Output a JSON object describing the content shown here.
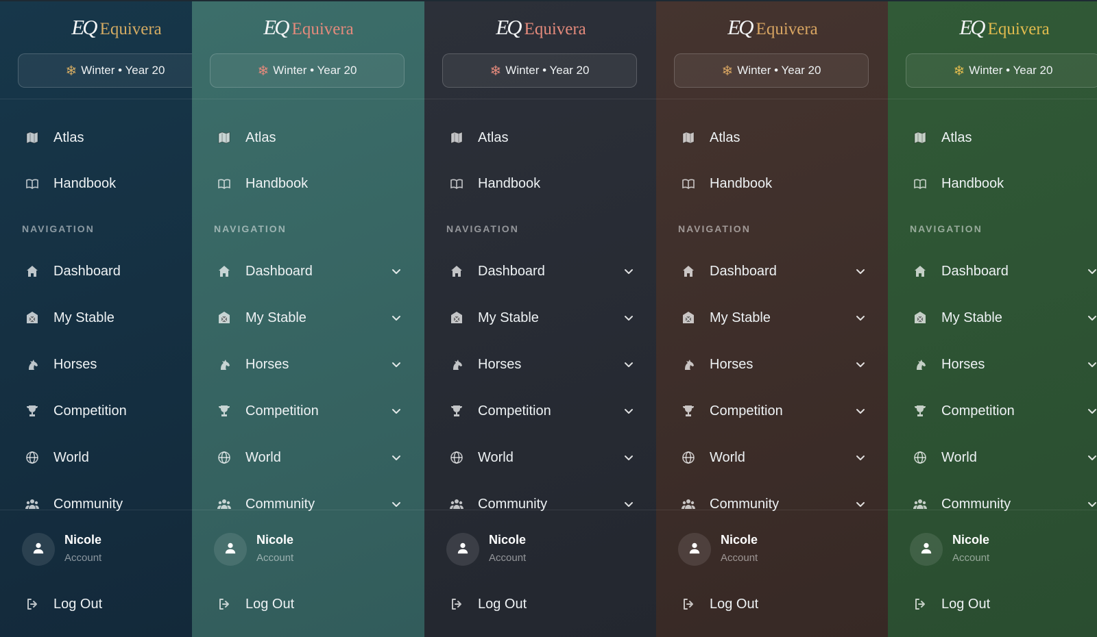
{
  "brand": {
    "mark": "EQ",
    "name": "Equivera"
  },
  "season": {
    "label": "Winter • Year 20",
    "icon": "snowflake-icon"
  },
  "quick_links": [
    {
      "label": "Atlas",
      "icon": "map-icon"
    },
    {
      "label": "Handbook",
      "icon": "book-icon"
    }
  ],
  "nav_section_label": "NAVIGATION",
  "nav_items": [
    {
      "label": "Dashboard",
      "icon": "home-icon"
    },
    {
      "label": "My Stable",
      "icon": "stable-icon"
    },
    {
      "label": "Horses",
      "icon": "horse-icon"
    },
    {
      "label": "Competition",
      "icon": "trophy-icon"
    },
    {
      "label": "World",
      "icon": "globe-icon"
    },
    {
      "label": "Community",
      "icon": "users-icon"
    }
  ],
  "user": {
    "name": "Nicole",
    "subtitle": "Account",
    "icon": "user-icon"
  },
  "logout": {
    "label": "Log Out",
    "icon": "logout-icon"
  },
  "themes": [
    {
      "name": "navy",
      "background": "#13293a",
      "logo_color": "#d3ab63",
      "accent": "#d3ab63"
    },
    {
      "name": "teal",
      "background": "#325c5b",
      "logo_color": "#e48a7c",
      "accent": "#e48a7c"
    },
    {
      "name": "charcoal",
      "background": "#23272f",
      "logo_color": "#e48a7c",
      "accent": "#e48a7c"
    },
    {
      "name": "brown",
      "background": "#372925",
      "logo_color": "#d8a562",
      "accent": "#d8a562"
    },
    {
      "name": "forest",
      "background": "#2a4d30",
      "logo_color": "#e0bb4e",
      "accent": "#e0bb4e"
    }
  ]
}
